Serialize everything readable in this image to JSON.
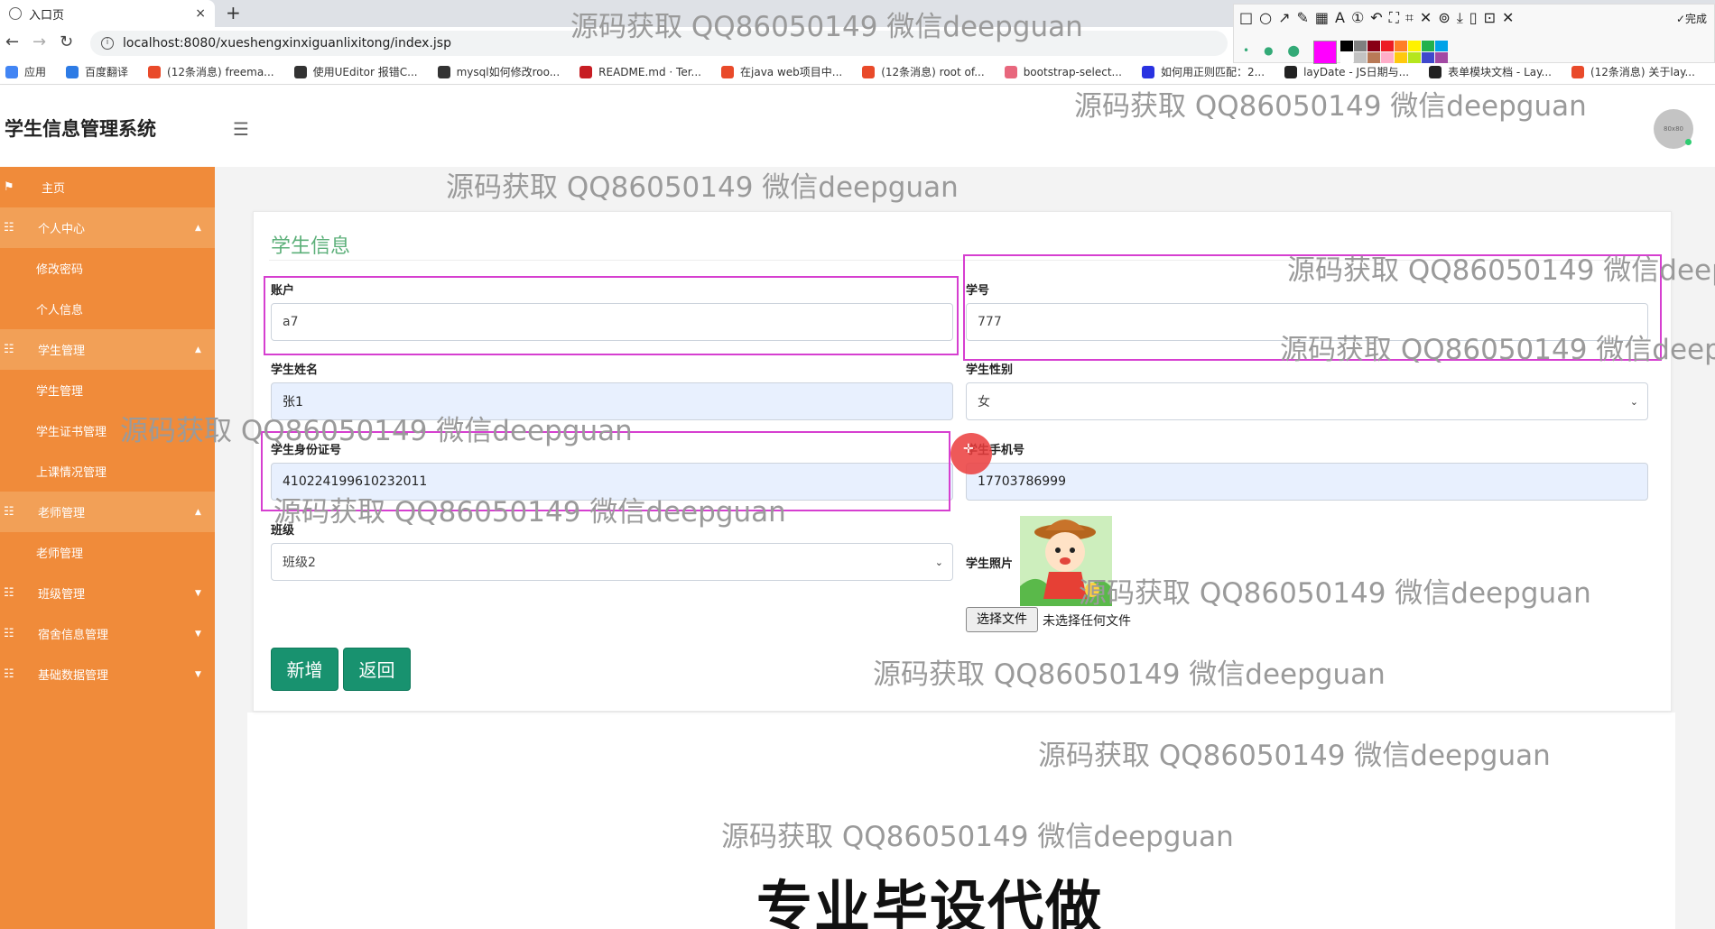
{
  "browser": {
    "tab_title": "入口页",
    "tab_close": "×",
    "new_tab": "+",
    "url": "localhost:8080/xueshengxinxiguanlixitong/index.jsp",
    "bookmarks": [
      {
        "label": "应用",
        "icon": "apps-icon",
        "color": "#4285f4"
      },
      {
        "label": "百度翻译",
        "icon": "translate-icon",
        "color": "#2d7be5"
      },
      {
        "label": "(12条消息) freema...",
        "icon": "csdn-icon",
        "color": "#e94a2a"
      },
      {
        "label": "使用UEditor 报错C...",
        "icon": "github-icon",
        "color": "#333333"
      },
      {
        "label": "mysql如何修改roo...",
        "icon": "github-icon",
        "color": "#333333"
      },
      {
        "label": "README.md · Ter...",
        "icon": "gitee-icon",
        "color": "#c71d23"
      },
      {
        "label": "在java web项目中...",
        "icon": "csdn-icon",
        "color": "#e94a2a"
      },
      {
        "label": "(12条消息) root of...",
        "icon": "csdn-icon",
        "color": "#e94a2a"
      },
      {
        "label": "bootstrap-select...",
        "icon": "bookmark-icon",
        "color": "#e8677d"
      },
      {
        "label": "如何用正则匹配：2...",
        "icon": "baidu-icon",
        "color": "#2932e1"
      },
      {
        "label": "layDate - JS日期与...",
        "icon": "layui-icon",
        "color": "#222222"
      },
      {
        "label": "表单模块文档 - Lay...",
        "icon": "layui-icon",
        "color": "#222222"
      },
      {
        "label": "(12条消息) 关于lay...",
        "icon": "csdn-icon",
        "color": "#e94a2a"
      }
    ]
  },
  "snip_toolbar": {
    "tools": "□○↗✎▦A①↶⛶⌗✕⊚⤓▯⊡✕",
    "done_label": "✓完成",
    "main_color": "#ff00ff",
    "palette": [
      "#000000",
      "#7f7f7f",
      "#880015",
      "#ed1c24",
      "#ff7f27",
      "#fff200",
      "#22b14c",
      "#00a2e8",
      "#ffffff",
      "#c3c3c3",
      "#b97a57",
      "#ffaec9",
      "#ffc90e",
      "#b5e61d",
      "#3f48cc",
      "#a349a4"
    ]
  },
  "app": {
    "title": "学生信息管理系统",
    "avatar_text": "80x80"
  },
  "sidebar": {
    "home": "主页",
    "personal_center": "个人中心",
    "change_password": "修改密码",
    "personal_info": "个人信息",
    "student_mgmt_group": "学生管理",
    "student_mgmt": "学生管理",
    "student_cert_mgmt": "学生证书管理",
    "class_attendance_mgmt": "上课情况管理",
    "teacher_mgmt_group": "老师管理",
    "teacher_mgmt": "老师管理",
    "class_mgmt": "班级管理",
    "dorm_mgmt": "宿舍信息管理",
    "basic_data_mgmt": "基础数据管理"
  },
  "form": {
    "title": "学生信息",
    "account_label": "账户",
    "account_value": "a7",
    "student_no_label": "学号",
    "student_no_value": "777",
    "name_label": "学生姓名",
    "name_value": "张1",
    "gender_label": "学生性别",
    "gender_value": "女",
    "id_card_label": "学生身份证号",
    "id_card_value": "410224199610232011",
    "phone_label": "学生手机号",
    "phone_value": "17703786999",
    "class_label": "班级",
    "class_value": "班级2",
    "photo_label": "学生照片",
    "choose_file": "选择文件",
    "no_file": "未选择任何文件",
    "submit_label": "新增",
    "back_label": "返回"
  },
  "overlay": {
    "watermark": "源码获取 QQ86050149 微信deepguan",
    "watermark_cut": "源码获取 QQ86050149 微信deepg",
    "ad_text": "专业毕设代做"
  },
  "colors": {
    "sidebar": "#f08b3a",
    "accent_green": "#18926f",
    "title_green": "#5db07a",
    "highlight": "#d63fd0"
  }
}
